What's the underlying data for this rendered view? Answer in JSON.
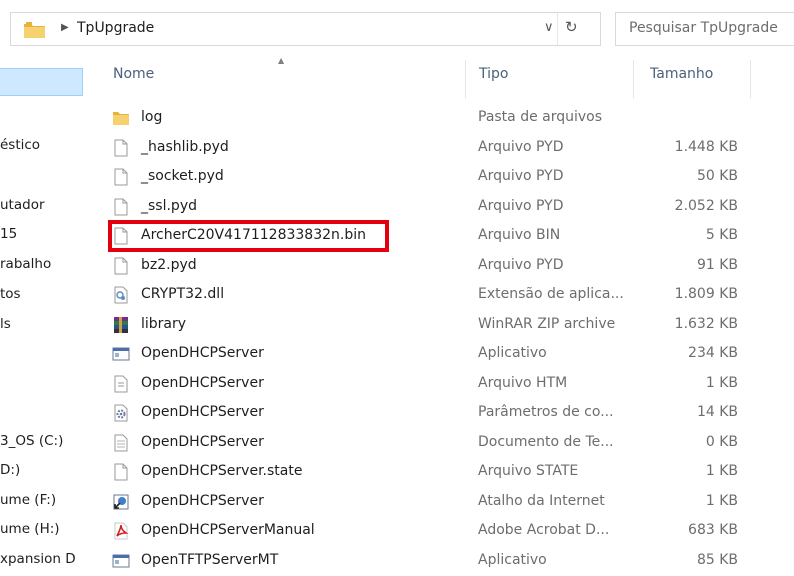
{
  "address_bar": {
    "folder_icon": "folder-icon",
    "crumb": "TpUpgrade",
    "separator": "▶",
    "dropdown": "∨",
    "refresh": "↻"
  },
  "search": {
    "placeholder": "Pesquisar TpUpgrade"
  },
  "sidebar": {
    "items": [
      "éstico",
      "utador",
      "15",
      "rabalho",
      "tos",
      "ls",
      "3_OS (C:)",
      "D:)",
      "ume (F:)",
      "ume (H:)",
      "xpansion D"
    ]
  },
  "columns": {
    "name": "Nome",
    "type": "Tipo",
    "size": "Tamanho"
  },
  "files": [
    {
      "name": "log",
      "type": "Pasta de arquivos",
      "size": "",
      "icon": "folder-icon"
    },
    {
      "name": "_hashlib.pyd",
      "type": "Arquivo PYD",
      "size": "1.448 KB",
      "icon": "file-icon"
    },
    {
      "name": "_socket.pyd",
      "type": "Arquivo PYD",
      "size": "50 KB",
      "icon": "file-icon"
    },
    {
      "name": "_ssl.pyd",
      "type": "Arquivo PYD",
      "size": "2.052 KB",
      "icon": "file-icon"
    },
    {
      "name": "ArcherC20V417112833832n.bin",
      "type": "Arquivo BIN",
      "size": "5 KB",
      "icon": "file-icon"
    },
    {
      "name": "bz2.pyd",
      "type": "Arquivo PYD",
      "size": "91 KB",
      "icon": "file-icon"
    },
    {
      "name": "CRYPT32.dll",
      "type": "Extensão de aplica...",
      "size": "1.809 KB",
      "icon": "dll-icon"
    },
    {
      "name": "library",
      "type": "WinRAR ZIP archive",
      "size": "1.632 KB",
      "icon": "winrar-icon"
    },
    {
      "name": "OpenDHCPServer",
      "type": "Aplicativo",
      "size": "234 KB",
      "icon": "application-icon"
    },
    {
      "name": "OpenDHCPServer",
      "type": "Arquivo HTM",
      "size": "1 KB",
      "icon": "htm-file-icon"
    },
    {
      "name": "OpenDHCPServer",
      "type": "Parâmetros de co...",
      "size": "14 KB",
      "icon": "settings-file-icon"
    },
    {
      "name": "OpenDHCPServer",
      "type": "Documento de Te...",
      "size": "0 KB",
      "icon": "text-document-icon"
    },
    {
      "name": "OpenDHCPServer.state",
      "type": "Arquivo STATE",
      "size": "1 KB",
      "icon": "file-icon"
    },
    {
      "name": "OpenDHCPServer",
      "type": "Atalho da Internet",
      "size": "1 KB",
      "icon": "internet-shortcut-icon"
    },
    {
      "name": "OpenDHCPServerManual",
      "type": "Adobe Acrobat D...",
      "size": "683 KB",
      "icon": "pdf-icon"
    },
    {
      "name": "OpenTFTPServerMT",
      "type": "Aplicativo",
      "size": "85 KB",
      "icon": "application-icon"
    }
  ],
  "highlight_color": "#e3000f"
}
